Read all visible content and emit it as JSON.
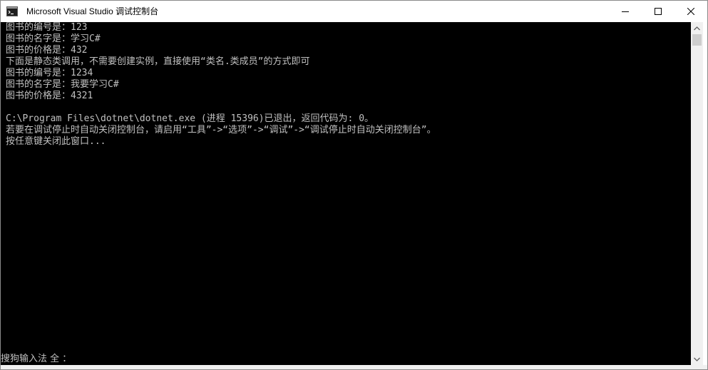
{
  "window": {
    "title": "Microsoft Visual Studio 调试控制台",
    "icons": {
      "app": "console-app-icon",
      "minimize": "minimize-icon",
      "maximize": "maximize-icon",
      "close": "close-icon"
    }
  },
  "console": {
    "lines": [
      "图书的编号是：123",
      "图书的名字是：学习C#",
      "图书的价格是：432",
      "下面是静态类调用，不需要创建实例，直接使用“类名.类成员”的方式即可",
      "图书的编号是：1234",
      "图书的名字是：我要学习C#",
      "图书的价格是：4321",
      "",
      "C:\\Program Files\\dotnet\\dotnet.exe (进程 15396)已退出，返回代码为: 0。",
      "若要在调试停止时自动关闭控制台，请启用“工具”->“选项”->“调试”->“调试停止时自动关闭控制台”。",
      "按任意键关闭此窗口..."
    ],
    "ime_status": "搜狗输入法 全 ："
  },
  "scrollbar": {
    "icons": {
      "up": "scroll-up-arrow-icon",
      "down": "scroll-down-arrow-icon"
    }
  },
  "colors": {
    "console_bg": "#000000",
    "console_text": "#c0c0c0",
    "titlebar_bg": "#ffffff"
  }
}
